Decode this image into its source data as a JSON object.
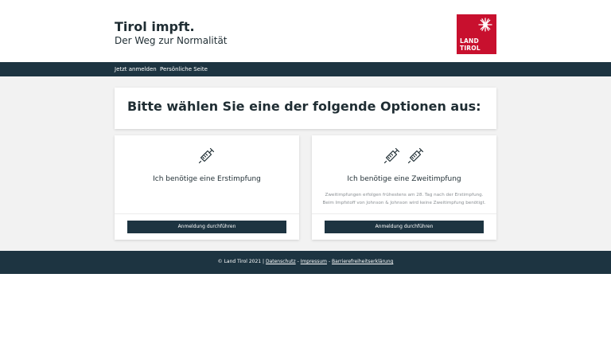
{
  "header": {
    "title": "Tirol impft.",
    "subtitle": "Der Weg zur Normalität",
    "logo": {
      "line1": "LAND",
      "line2": "TIROL",
      "icon": "eagle-emblem-icon",
      "color": "#c8102e"
    }
  },
  "nav": {
    "items": [
      {
        "label": "Jetzt anmelden"
      },
      {
        "label": "Persönliche Seite"
      }
    ]
  },
  "main": {
    "prompt": "Bitte wählen Sie eine der folgende Optionen aus:",
    "options": [
      {
        "icon": "syringe-icon",
        "title": "Ich benötige eine Erstimpfung",
        "note_line1": "",
        "note_line2": "",
        "button": "Anmeldung durchführen"
      },
      {
        "icon": "two-syringes-icon",
        "title": "Ich benötige eine Zweitimpfung",
        "note_line1": "Zweitimpfungen erfolgen frühestens am 28. Tag nach der Erstimpfung.",
        "note_line2": "Beim Impfstoff von Johnson & Johnson wird keine Zweitimpfung benötigt.",
        "button": "Anmeldung durchführen"
      }
    ]
  },
  "footer": {
    "copyright": "© Land Tirol 2021 |",
    "links": [
      "Datenschutz",
      "Impressum",
      "Barrierefreiheitserklärung"
    ],
    "separator": "-"
  },
  "colors": {
    "primary_dark": "#1d3441",
    "brand_red": "#c8102e",
    "background_gray": "#f2f2f2"
  }
}
